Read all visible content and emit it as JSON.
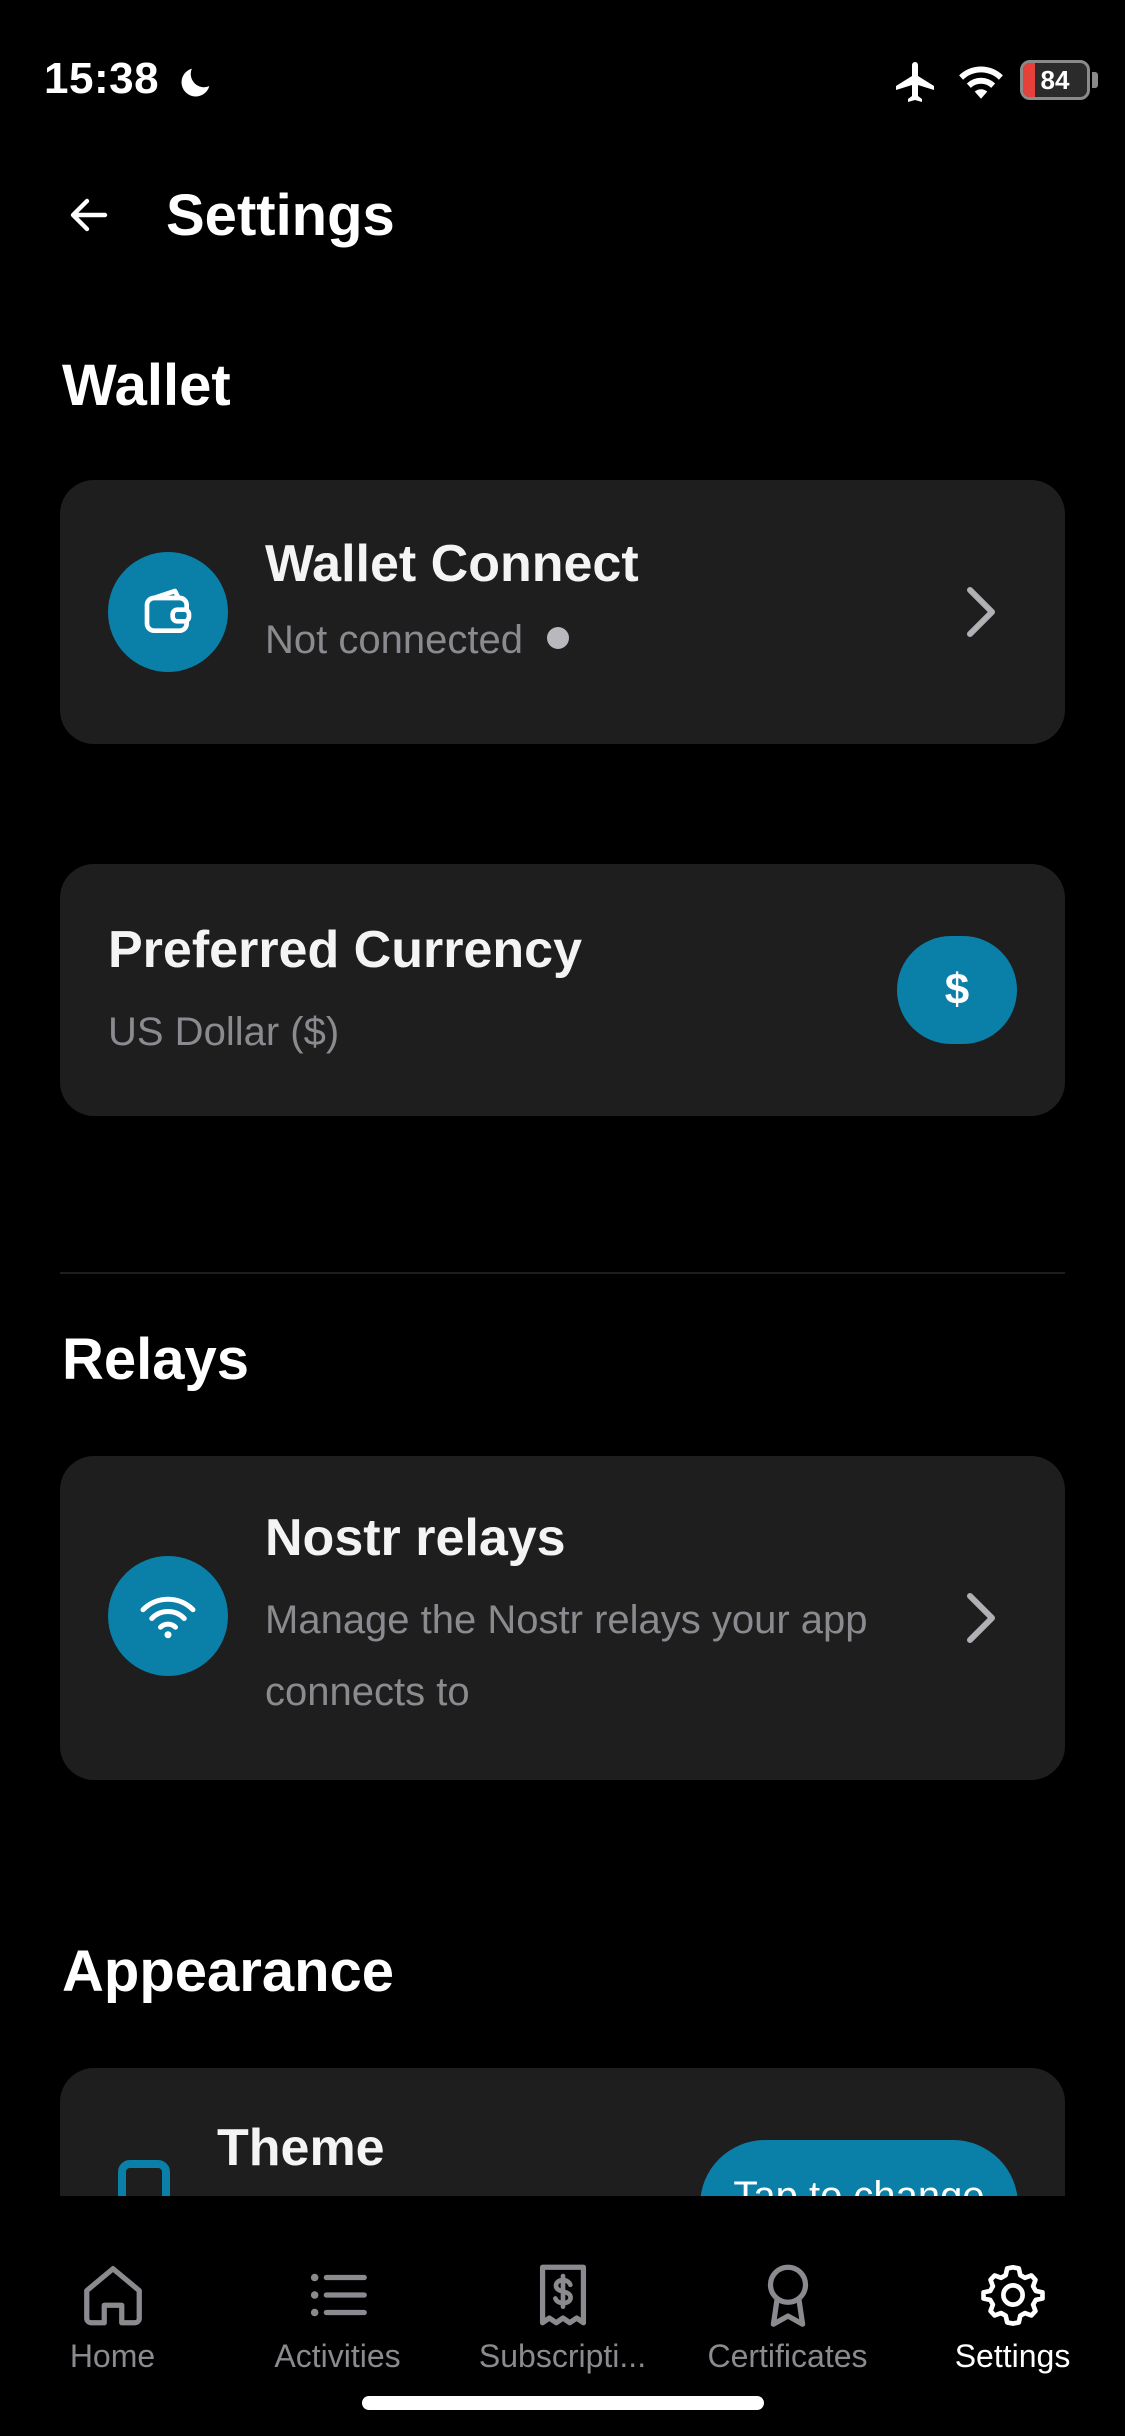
{
  "status_bar": {
    "time": "15:38",
    "battery": {
      "label": "84",
      "level": 0.18
    },
    "icons": [
      "moon-icon",
      "airplane-icon",
      "wifi-icon",
      "battery-icon"
    ]
  },
  "header": {
    "title": "Settings"
  },
  "sections": {
    "wallet": {
      "heading": "Wallet",
      "wallet_connect": {
        "title": "Wallet Connect",
        "status": "Not connected",
        "icon": "wallet-icon"
      },
      "currency": {
        "title": "Preferred Currency",
        "value": "US Dollar ($)",
        "badge": "$"
      }
    },
    "relays": {
      "heading": "Relays",
      "nostr": {
        "title": "Nostr relays",
        "description_line1": "Manage the Nostr relays your app",
        "description_line2": "connects to",
        "icon": "wifi-icon"
      }
    },
    "appearance": {
      "heading": "Appearance",
      "theme": {
        "title": "Theme",
        "button": "Tap to change"
      }
    }
  },
  "tab_bar": {
    "items": [
      {
        "label": "Home",
        "icon": "home-icon"
      },
      {
        "label": "Activities",
        "icon": "list-icon"
      },
      {
        "label": "Subscripti...",
        "icon": "receipt-icon"
      },
      {
        "label": "Certificates",
        "icon": "award-icon"
      },
      {
        "label": "Settings",
        "icon": "gear-icon",
        "active": true
      }
    ]
  },
  "colors": {
    "accent": "#0a7fa8",
    "card": "#1e1e1f",
    "background": "#000000",
    "muted_text": "#8a8a8f"
  }
}
